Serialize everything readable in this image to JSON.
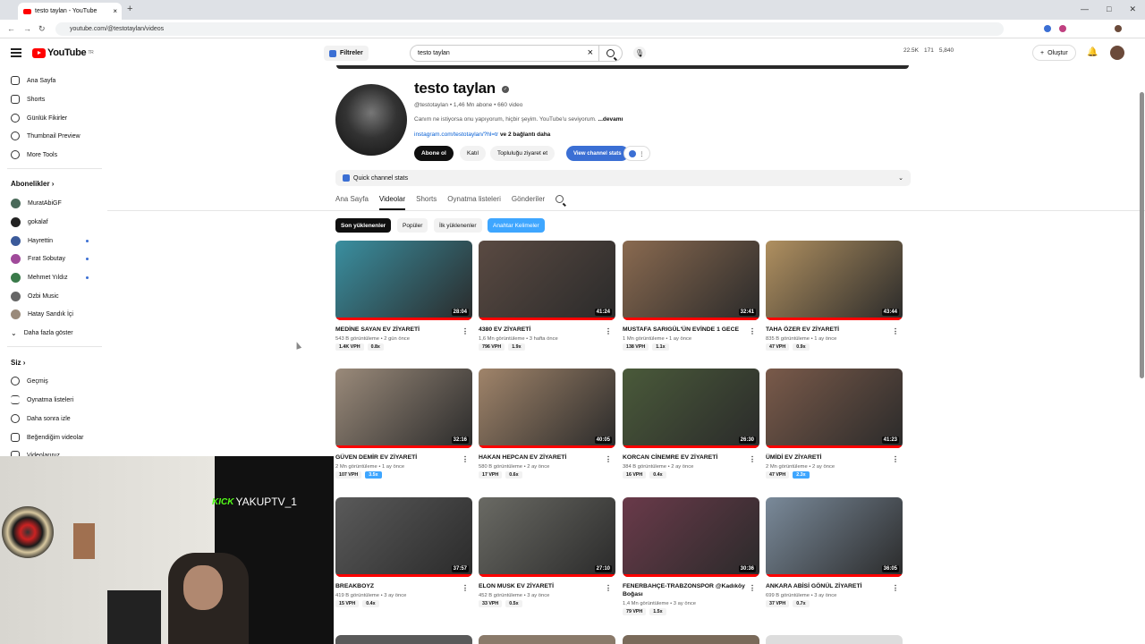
{
  "browser": {
    "tab_title": "testo taylan - YouTube",
    "url": "youtube.com/@testotaylan/videos"
  },
  "header": {
    "logo": "YouTube",
    "logo_region": "TR",
    "filters_label": "Filtreler",
    "search_value": "testo taylan",
    "stats": [
      "22.5K",
      "171",
      "5,840"
    ],
    "create_label": "Oluştur"
  },
  "sidebar": {
    "top_items": [
      "Ana Sayfa",
      "Shorts",
      "Günlük Fikirler",
      "Thumbnail Preview",
      "More Tools"
    ],
    "subs_heading": "Abonelikler",
    "subs": [
      "MuratAbiGF",
      "gokalaf",
      "Hayrettin",
      "Fırat Sobutay",
      "Mehmet Yıldız",
      "Ozbi Music",
      "Hatay Sandık İçi"
    ],
    "more_label": "Daha fazla göster",
    "you_heading": "Siz",
    "you_items": [
      "Geçmiş",
      "Oynatma listeleri",
      "Daha sonra izle",
      "Beğendiğim videolar",
      "Videolarınız"
    ]
  },
  "channel": {
    "name": "testo taylan",
    "meta": "@testotaylan • 1,46 Mn abone • 660 video",
    "desc": "Canım ne istiyorsa onu yapıyorum, hiçbir şeyim. YouTube'u seviyorum.",
    "desc_more": "...devamı",
    "link": "instagram.com/testotaylan/?hl=tr",
    "link_more": "ve 2 bağlantı daha",
    "subscribe": "Abone ol",
    "join": "Katıl",
    "community": "Topluluğu ziyaret et",
    "view_stats": "View channel stats",
    "quick_stats": "Quick channel stats"
  },
  "tabs": [
    "Ana Sayfa",
    "Videolar",
    "Shorts",
    "Oynatma listeleri",
    "Gönderiler"
  ],
  "chips": [
    "Son yüklenenler",
    "Popüler",
    "İlk yüklenenler",
    "Anahtar Kelimeler"
  ],
  "videos": [
    {
      "title": "MEDİNE SAYAN EV ZİYARETİ",
      "meta": "543 B görüntüleme • 2 gün önce",
      "dur": "28:04",
      "b1": "1.4K VPH",
      "b2": "0.8x",
      "c": "#3a8fa0"
    },
    {
      "title": "4380 EV ZİYARETİ",
      "meta": "1,6 Mn görüntüleme • 3 hafta önce",
      "dur": "41:24",
      "b1": "796 VPH",
      "b2": "1.9x",
      "c": "#5a4a42"
    },
    {
      "title": "MUSTAFA SARIGÜL'ÜN EVİNDE 1 GECE",
      "meta": "1 Mn görüntüleme • 1 ay önce",
      "dur": "32:41",
      "b1": "138 VPH",
      "b2": "1.1x",
      "c": "#8a6a50"
    },
    {
      "title": "TAHA ÖZER EV ZİYARETİ",
      "meta": "835 B görüntüleme • 1 ay önce",
      "dur": "43:44",
      "b1": "47 VPH",
      "b2": "0.9x",
      "c": "#b09060"
    },
    {
      "title": "GÜVEN DEMİR EV ZİYARETİ",
      "meta": "2 Mn görüntüleme • 1 ay önce",
      "dur": "32:16",
      "b1": "107 VPH",
      "b2": "3.5x",
      "c": "#9a8a7a",
      "hi": true
    },
    {
      "title": "HAKAN HEPCAN EV ZİYARETİ",
      "meta": "580 B görüntüleme • 2 ay önce",
      "dur": "40:05",
      "b1": "17 VPH",
      "b2": "0.6x",
      "c": "#a0846a"
    },
    {
      "title": "KORCAN CİNEMRE EV ZİYARETİ",
      "meta": "384 B görüntüleme • 2 ay önce",
      "dur": "26:30",
      "b1": "16 VPH",
      "b2": "0.4x",
      "c": "#4a5a3a"
    },
    {
      "title": "ÜMİDİ EV ZİYARETİ",
      "meta": "2 Mn görüntüleme • 2 ay önce",
      "dur": "41:23",
      "b1": "47 VPH",
      "b2": "2.3x",
      "c": "#7a5a4a",
      "hi": true
    },
    {
      "title": "BREAKBOYZ",
      "meta": "419 B görüntüleme • 3 ay önce",
      "dur": "37:57",
      "b1": "15 VPH",
      "b2": "0.4x",
      "c": "#5a5a5a"
    },
    {
      "title": "ELON MUSK EV ZİYARETİ",
      "meta": "452 B görüntüleme • 3 ay önce",
      "dur": "27:10",
      "b1": "33 VPH",
      "b2": "0.5x",
      "c": "#6a6a64"
    },
    {
      "title": "FENERBAHÇE-TRABZONSPOR @Kadıköy Boğası",
      "meta": "1,4 Mn görüntüleme • 3 ay önce",
      "dur": "30:36",
      "b1": "79 VPH",
      "b2": "1.5x",
      "c": "#6a3a4a"
    },
    {
      "title": "ANKARA ABİSİ GÖNÜL ZİYARETİ",
      "meta": "699 B görüntüleme • 3 ay önce",
      "dur": "36:05",
      "b1": "37 VPH",
      "b2": "0.7x",
      "c": "#7a8a9a"
    }
  ],
  "overlay": {
    "brand": "KICK",
    "handle": "YAKUPTV_1"
  }
}
